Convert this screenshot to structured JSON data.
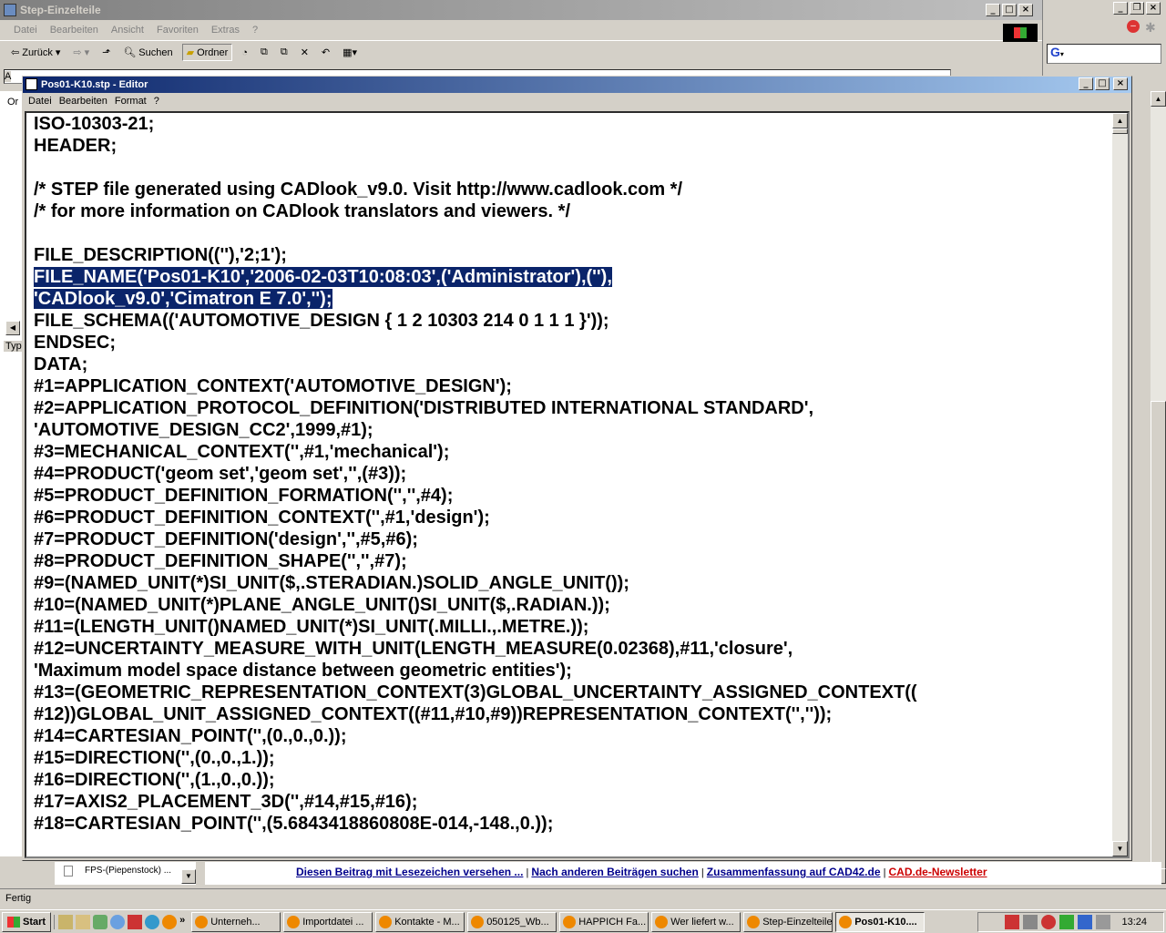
{
  "explorer": {
    "title": "Step-Einzelteile",
    "menu": [
      "Datei",
      "Bearbeiten",
      "Ansicht",
      "Favoriten",
      "Extras",
      "?"
    ],
    "back_label": "Zurück",
    "search_label": "Suchen",
    "folder_label": "Ordner",
    "side_label_1": "Or",
    "side_label_2": "Typ",
    "side_label_3": "A"
  },
  "notepad": {
    "title": "Pos01-K10.stp - Editor",
    "menu": [
      "Datei",
      "Bearbeiten",
      "Format",
      "?"
    ],
    "lines": [
      "ISO-10303-21;",
      "HEADER;",
      "",
      "/* STEP file generated using CADlook_v9.0. Visit http://www.cadlook.com */",
      "/* for more information on CADlook translators and viewers. */",
      "",
      "FILE_DESCRIPTION((''),'2;1');",
      "FILE_NAME('Pos01-K10','2006-02-03T10:08:03',('Administrator'),(''),",
      "'CADlook_v9.0','Cimatron E 7.0','');",
      "FILE_SCHEMA(('AUTOMOTIVE_DESIGN { 1 2 10303 214 0 1 1 1 }'));",
      "ENDSEC;",
      "DATA;",
      "#1=APPLICATION_CONTEXT('AUTOMOTIVE_DESIGN');",
      "#2=APPLICATION_PROTOCOL_DEFINITION('DISTRIBUTED INTERNATIONAL STANDARD',",
      "'AUTOMOTIVE_DESIGN_CC2',1999,#1);",
      "#3=MECHANICAL_CONTEXT('',#1,'mechanical');",
      "#4=PRODUCT('geom set','geom set','',(#3));",
      "#5=PRODUCT_DEFINITION_FORMATION('','',#4);",
      "#6=PRODUCT_DEFINITION_CONTEXT('',#1,'design');",
      "#7=PRODUCT_DEFINITION('design','',#5,#6);",
      "#8=PRODUCT_DEFINITION_SHAPE('','',#7);",
      "#9=(NAMED_UNIT(*)SI_UNIT($,.STERADIAN.)SOLID_ANGLE_UNIT());",
      "#10=(NAMED_UNIT(*)PLANE_ANGLE_UNIT()SI_UNIT($,.RADIAN.));",
      "#11=(LENGTH_UNIT()NAMED_UNIT(*)SI_UNIT(.MILLI.,.METRE.));",
      "#12=UNCERTAINTY_MEASURE_WITH_UNIT(LENGTH_MEASURE(0.02368),#11,'closure',",
      "'Maximum model space distance between geometric entities');",
      "#13=(GEOMETRIC_REPRESENTATION_CONTEXT(3)GLOBAL_UNCERTAINTY_ASSIGNED_CONTEXT((",
      "#12))GLOBAL_UNIT_ASSIGNED_CONTEXT((#11,#10,#9))REPRESENTATION_CONTEXT('',''));",
      "#14=CARTESIAN_POINT('',(0.,0.,0.));",
      "#15=DIRECTION('',(0.,0.,1.));",
      "#16=DIRECTION('',(1.,0.,0.));",
      "#17=AXIS2_PLACEMENT_3D('',#14,#15,#16);",
      "#18=CARTESIAN_POINT('',(5.6843418860808E-014,-148.,0.));"
    ],
    "selected_lines": [
      7,
      8
    ]
  },
  "links": [
    {
      "text": "Diesen Beitrag mit Lesezeichen versehen ...",
      "color": "#00008b"
    },
    {
      "text": "Nach anderen Beiträgen suchen",
      "color": "#00008b"
    },
    {
      "text": "Zusammenfassung auf CAD42.de",
      "color": "#00008b"
    },
    {
      "text": "CAD.de-Newsletter",
      "color": "#cc0000"
    }
  ],
  "tree_items": [
    "FPS-(Piepenstock) ..."
  ],
  "status": "Fertig",
  "taskbar": {
    "start": "Start",
    "tasks": [
      "Unterneh...",
      "Importdatei ...",
      "Kontakte - M...",
      "050125_Wb...",
      "HAPPICH Fa...",
      "Wer liefert w...",
      "Step-Einzelteile",
      "Pos01-K10...."
    ],
    "active_task": 7,
    "clock": "13:24"
  }
}
